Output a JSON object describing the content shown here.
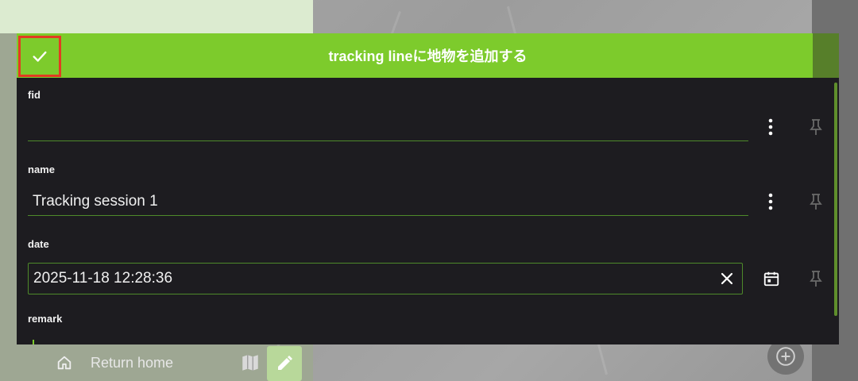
{
  "dialog": {
    "title": "tracking lineに地物を追加する",
    "confirm_icon": "check-icon"
  },
  "fields": [
    {
      "label": "fid",
      "value": "",
      "menu_icon": "more-vert-icon",
      "pin_icon": "pin-icon"
    },
    {
      "label": "name",
      "value": "Tracking session 1",
      "menu_icon": "more-vert-icon",
      "pin_icon": "pin-icon"
    },
    {
      "label": "date",
      "value": "2025-11-18 12:28:36",
      "clear_icon": "close-icon",
      "calendar_icon": "calendar-icon",
      "pin_icon": "pin-icon"
    },
    {
      "label": "remark",
      "value": ""
    }
  ],
  "background": {
    "return_home_label": "Return home",
    "home_icon": "home-icon",
    "map_icon": "map-icon",
    "edit_icon": "pencil-icon",
    "add_icon": "add-circle-icon"
  },
  "colors": {
    "accent": "#7dcb2c",
    "dialog_bg": "#1d1c20",
    "highlight": "#e23b22"
  }
}
